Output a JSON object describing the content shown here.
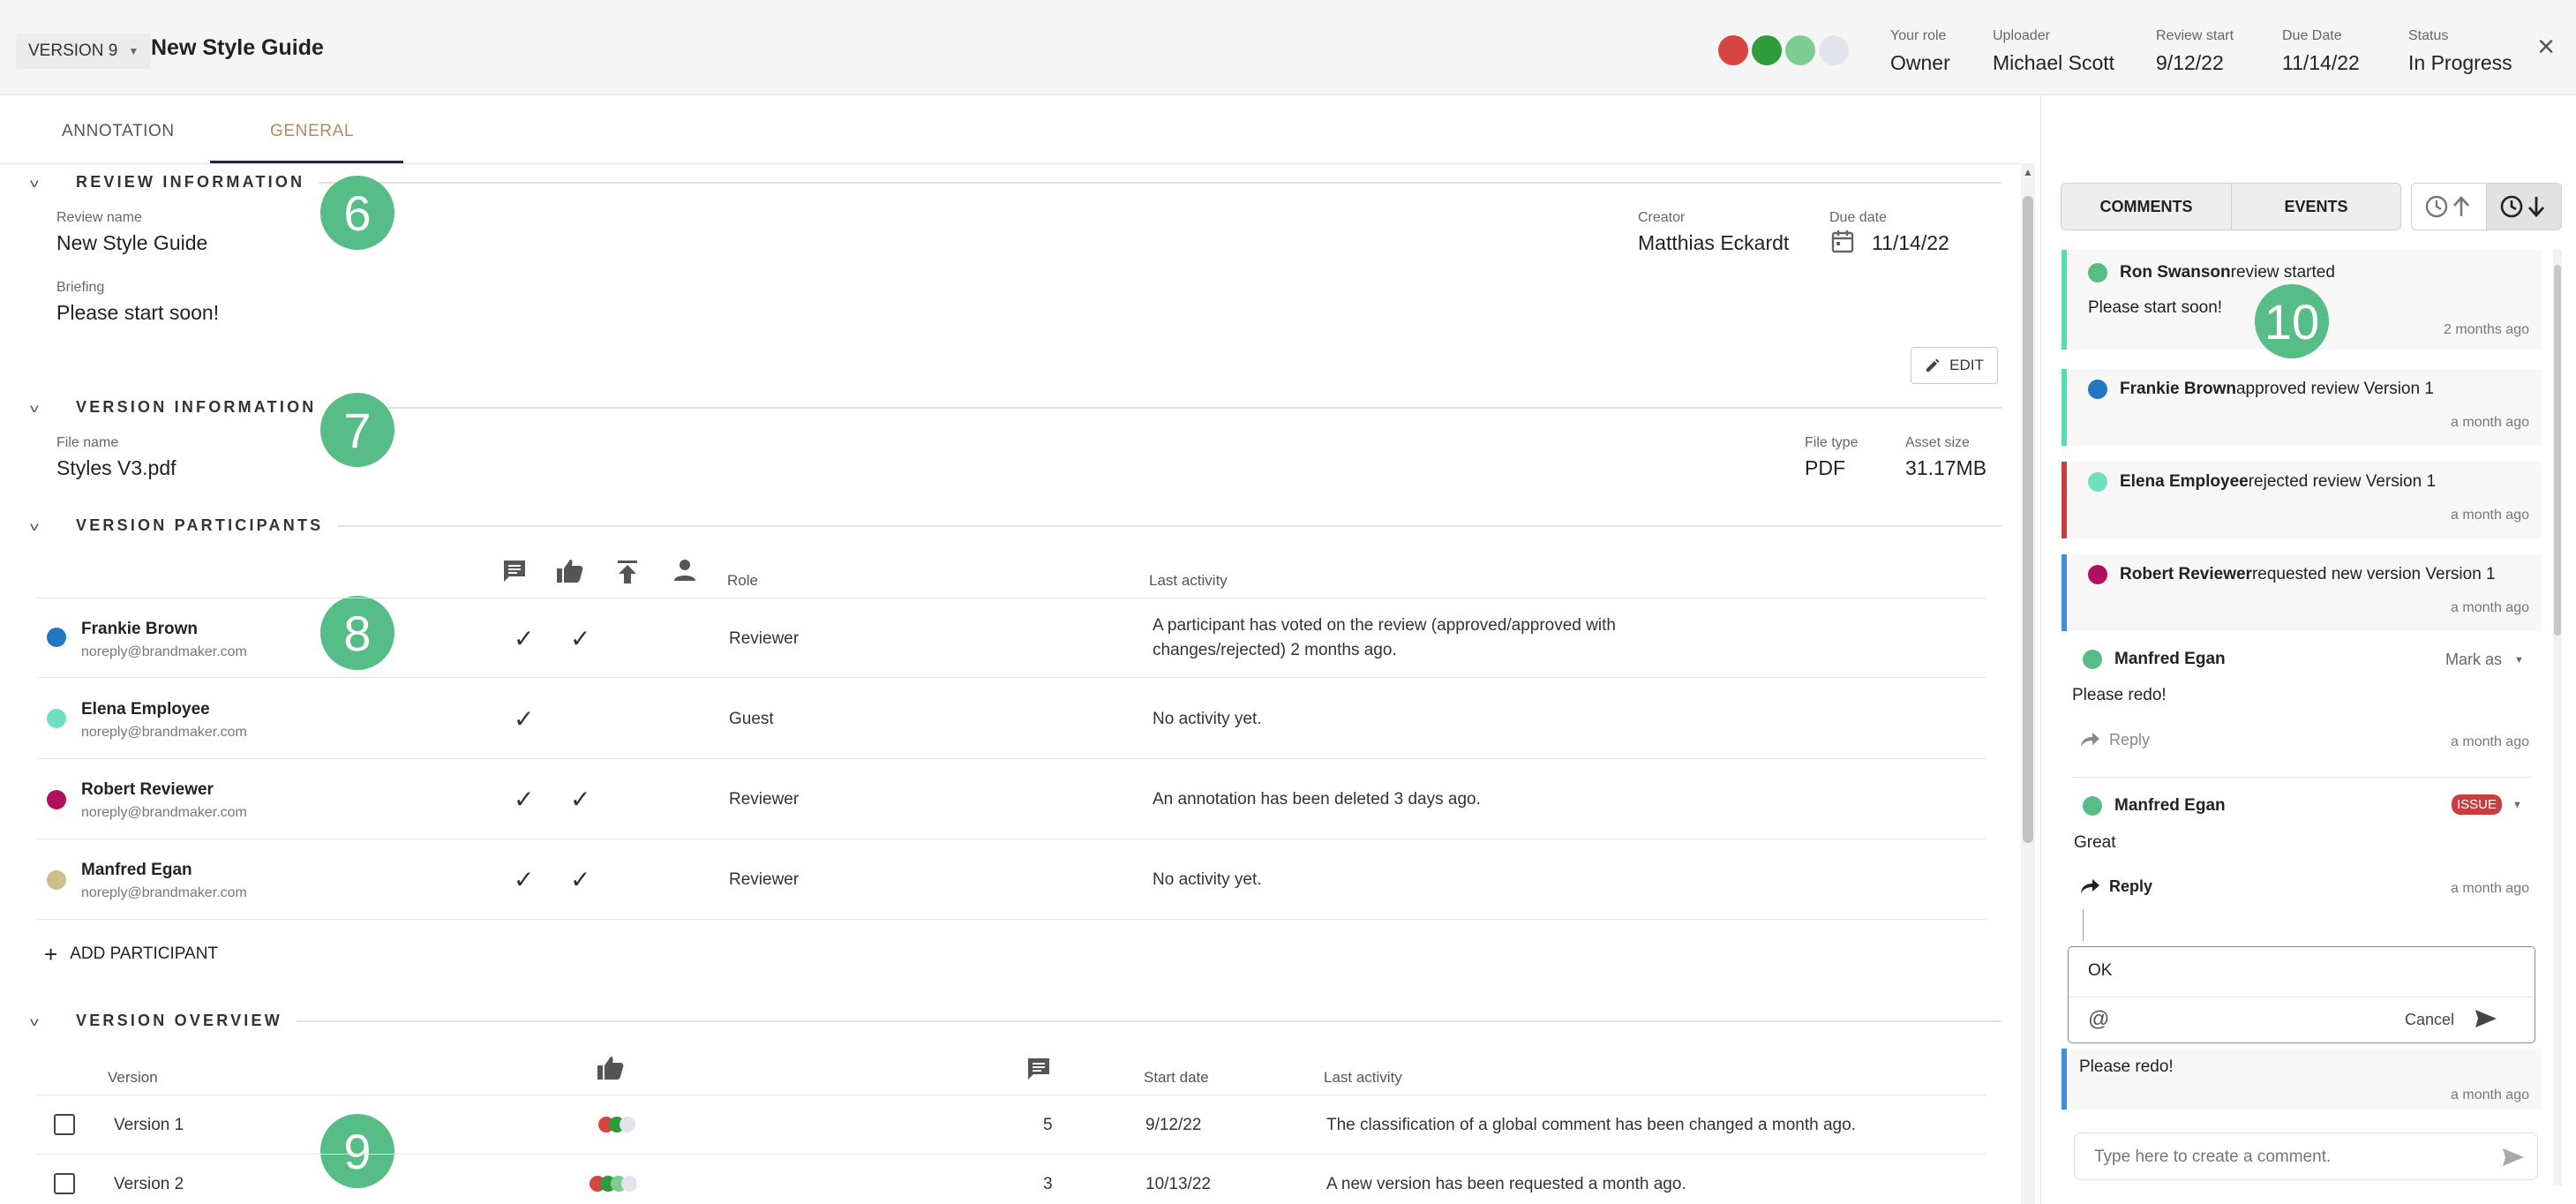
{
  "header": {
    "version_label": "VERSION 9",
    "title": "New Style Guide",
    "status_dots": [
      "#d64541",
      "#2e9b3c",
      "#7fcc93",
      "#e1e4ec"
    ],
    "meta": [
      {
        "label": "Your role",
        "value": "Owner"
      },
      {
        "label": "Uploader",
        "value": "Michael Scott"
      },
      {
        "label": "Review start",
        "value": "9/12/22"
      },
      {
        "label": "Due Date",
        "value": "11/14/22"
      },
      {
        "label": "Status",
        "value": "In Progress"
      }
    ]
  },
  "tabs": [
    {
      "label": "ANNOTATION",
      "active": false
    },
    {
      "label": "GENERAL",
      "active": true
    }
  ],
  "review_info": {
    "section_title": "REVIEW INFORMATION",
    "badge": "6",
    "review_name_label": "Review name",
    "review_name": "New Style Guide",
    "creator_label": "Creator",
    "creator": "Matthias Eckardt",
    "due_date_label": "Due date",
    "due_date": "11/14/22",
    "briefing_label": "Briefing",
    "briefing": "Please start soon!",
    "edit_label": "EDIT"
  },
  "version_info": {
    "section_title": "VERSION INFORMATION",
    "badge": "7",
    "file_name_label": "File name",
    "file_name": "Styles V3.pdf",
    "file_type_label": "File type",
    "file_type": "PDF",
    "asset_size_label": "Asset size",
    "asset_size": "31.17MB"
  },
  "participants": {
    "section_title": "VERSION PARTICIPANTS",
    "badge": "8",
    "col_role": "Role",
    "col_last_activity": "Last activity",
    "rows": [
      {
        "name": "Frankie Brown",
        "email": "noreply@brandmaker.com",
        "color": "#1f78c1",
        "c1": "✓",
        "c2": "✓",
        "role": "Reviewer",
        "activity1": "A participant has voted on the review (approved/approved with",
        "activity2": "changes/rejected) 2 months ago."
      },
      {
        "name": "Elena Employee",
        "email": "noreply@brandmaker.com",
        "color": "#6ee0c0",
        "c1": "✓",
        "c2": "",
        "role": "Guest",
        "activity1": "No activity yet.",
        "activity2": ""
      },
      {
        "name": "Robert Reviewer",
        "email": "noreply@brandmaker.com",
        "color": "#b0105e",
        "c1": "✓",
        "c2": "✓",
        "role": "Reviewer",
        "activity1": "An annotation has been deleted 3 days ago.",
        "activity2": ""
      },
      {
        "name": "Manfred Egan",
        "email": "noreply@brandmaker.com",
        "color": "#cbbf8a",
        "c1": "✓",
        "c2": "✓",
        "role": "Reviewer",
        "activity1": "No activity yet.",
        "activity2": ""
      }
    ],
    "add_label": "ADD PARTICIPANT"
  },
  "overview": {
    "section_title": "VERSION OVERVIEW",
    "badge": "9",
    "col_version": "Version",
    "col_start": "Start date",
    "col_last": "Last activity",
    "rows": [
      {
        "version": "Version 1",
        "dots": [
          "#d64541",
          "#2e9b3c",
          "#e1e4ec"
        ],
        "comments": "5",
        "start": "9/12/22",
        "activity": "The classification of a global comment has been changed a month ago."
      },
      {
        "version": "Version 2",
        "dots": [
          "#d64541",
          "#2e9b3c",
          "#7fcc93",
          "#e1e4ec"
        ],
        "comments": "3",
        "start": "10/13/22",
        "activity": "A new version has been requested a month ago."
      }
    ]
  },
  "panel": {
    "tab_comments": "COMMENTS",
    "tab_events": "EVENTS",
    "badge": "10",
    "events": [
      {
        "who": "Ron Swanson",
        "what": " review started",
        "note": "Please start soon!",
        "time": "2 months ago",
        "dot": "#56bd86",
        "bar": "#56dcb4"
      },
      {
        "who": "Frankie Brown",
        "what": " approved review Version 1",
        "note": "",
        "time": "a month ago",
        "dot": "#1f78c1",
        "bar": "#56dcb4"
      },
      {
        "who": "Elena Employee",
        "what": " rejected review Version 1",
        "note": "",
        "time": "a month ago",
        "dot": "#6ee0c0",
        "bar": "#c83e3e"
      },
      {
        "who": "Robert Reviewer",
        "what": " requested new version Version 1",
        "note": "",
        "time": "a month ago",
        "dot": "#b0105e",
        "bar": "#3d8de0"
      }
    ],
    "comment1": {
      "who": "Manfred Egan",
      "mark": "Mark as",
      "text": "Please redo!",
      "reply": "Reply",
      "time": "a month ago"
    },
    "comment2": {
      "who": "Manfred Egan",
      "tag": "ISSUE",
      "text": "Great",
      "reply": "Reply",
      "time": "a month ago"
    },
    "reply_box": {
      "value": "OK",
      "at": "@",
      "cancel": "Cancel"
    },
    "bottom_event": {
      "text": "Please redo!",
      "time": "a month ago"
    },
    "input_placeholder": "Type here to create a comment."
  }
}
